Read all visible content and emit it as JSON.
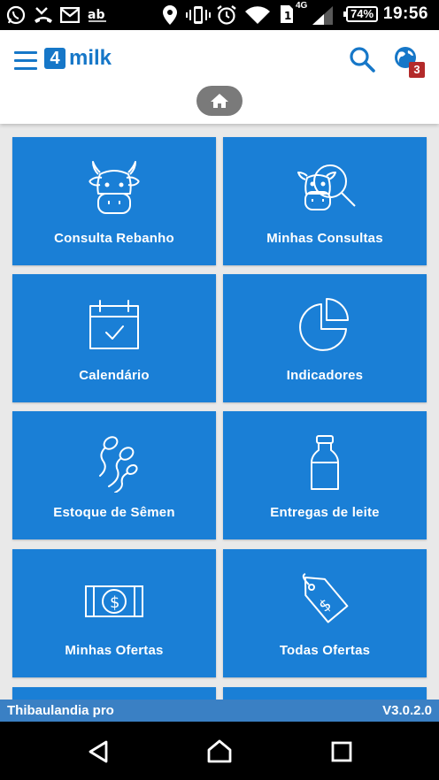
{
  "status_bar": {
    "time": "19:56",
    "battery": "74%",
    "network": "4G"
  },
  "header": {
    "menu_icon": "menu-icon",
    "logo_mark": "4",
    "logo_text": "milk",
    "notification_count": "3"
  },
  "tiles": [
    {
      "label": "Consulta Rebanho",
      "icon": "cow-head-icon"
    },
    {
      "label": "Minhas Consultas",
      "icon": "cow-search-icon"
    },
    {
      "label": "Calendário",
      "icon": "calendar-check-icon"
    },
    {
      "label": "Indicadores",
      "icon": "pie-chart-icon"
    },
    {
      "label": "Estoque de Sêmen",
      "icon": "semen-icon"
    },
    {
      "label": "Entregas de leite",
      "icon": "milk-bottle-icon"
    },
    {
      "label": "Minhas Ofertas",
      "icon": "money-bill-icon"
    },
    {
      "label": "Todas Ofertas",
      "icon": "price-tag-icon"
    }
  ],
  "footer": {
    "farm_name": "Thibaulandia pro",
    "version": "V3.0.2.0"
  },
  "colors": {
    "primary": "#1a7fd6",
    "brand": "#1677c8",
    "footer": "#3a80c4",
    "badge": "#b32a2a"
  }
}
